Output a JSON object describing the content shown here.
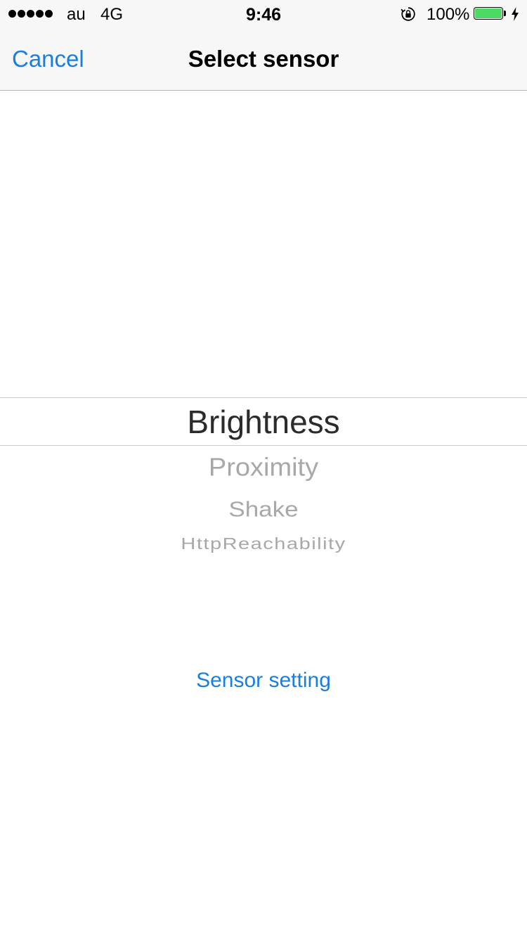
{
  "status_bar": {
    "signal_dots": 5,
    "carrier": "au",
    "network": "4G",
    "time": "9:46",
    "orientation_lock_icon": "orientation-lock-icon",
    "battery_percent": "100%",
    "battery_level": 1.0,
    "battery_color": "#4cd964",
    "charging_icon": "charging-bolt-icon"
  },
  "nav": {
    "cancel_label": "Cancel",
    "title": "Select sensor",
    "accent_color": "#1a7ee0"
  },
  "picker": {
    "items": [
      {
        "label": "Brightness",
        "selected": true
      },
      {
        "label": "Proximity",
        "selected": false
      },
      {
        "label": "Shake",
        "selected": false
      },
      {
        "label": "HttpReachability",
        "selected": false
      }
    ],
    "selected_index": 0
  },
  "footer": {
    "sensor_setting_label": "Sensor setting"
  }
}
